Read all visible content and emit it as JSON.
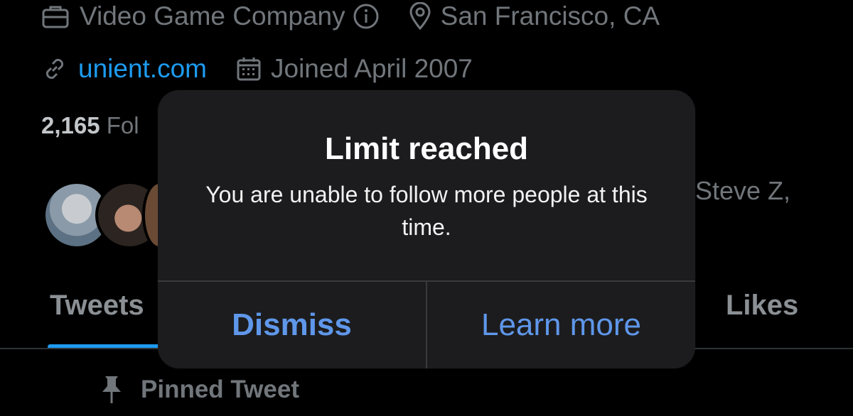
{
  "profile": {
    "category": "Video Game Company",
    "location": "San Francisco, CA",
    "website": "unient.com",
    "joined": "Joined April 2007",
    "followers_count": "2,165",
    "followers_label_partial": "Fol",
    "followed_by_partial": "Steve Z,"
  },
  "tabs": [
    {
      "label": "Tweets",
      "selected": true
    },
    {
      "label": "Likes",
      "selected": false
    }
  ],
  "pinned": {
    "label": "Pinned Tweet"
  },
  "alert": {
    "title": "Limit reached",
    "message": "You are unable to follow more people at this time.",
    "dismiss": "Dismiss",
    "learn_more": "Learn more"
  },
  "colors": {
    "accent": "#1d9bf0",
    "alert_button": "#5f97ea",
    "alert_bg": "#1c1c1e"
  },
  "icons": [
    "briefcase-icon",
    "info-icon",
    "location-pin-icon",
    "link-icon",
    "calendar-icon",
    "pin-icon"
  ]
}
